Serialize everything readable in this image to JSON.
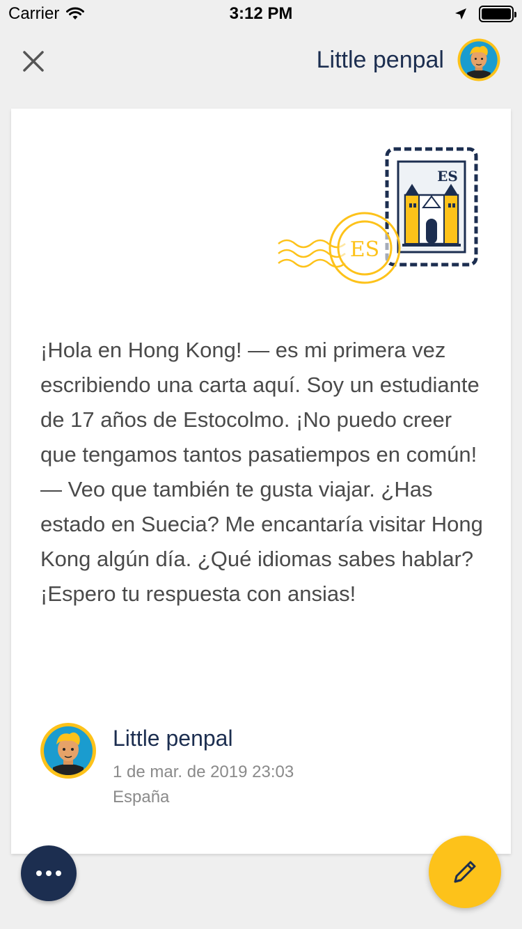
{
  "status_bar": {
    "carrier": "Carrier",
    "time": "3:12 PM",
    "icons": [
      "wifi-icon",
      "location-arrow-icon",
      "battery-icon"
    ]
  },
  "nav": {
    "close_icon": "close-icon",
    "user_name": "Little penpal"
  },
  "letter": {
    "stamp_code": "ES",
    "postmark_code": "ES",
    "body": "¡Hola en Hong Kong! — es mi primera vez escribiendo una carta aquí. Soy un estudiante de 17 años de Estocolmo. ¡No puedo creer que tengamos tantos pasatiempos en común! — Veo que también te gusta viajar. ¿Has estado en Suecia? Me encantaría visitar Hong Kong algún día. ¿Qué idiomas sabes hablar? ¡Espero tu respuesta con ansias!",
    "author": {
      "name": "Little penpal",
      "date": "1 de mar. de 2019 23:03",
      "country": "España"
    }
  },
  "actions": {
    "more_icon": "more-horizontal-icon",
    "write_icon": "pencil-icon"
  },
  "colors": {
    "navy": "#1c2e50",
    "accent_yellow": "#fdc21a",
    "background": "#efefef",
    "text": "#4a4a4a",
    "muted": "#8a8a8a"
  }
}
